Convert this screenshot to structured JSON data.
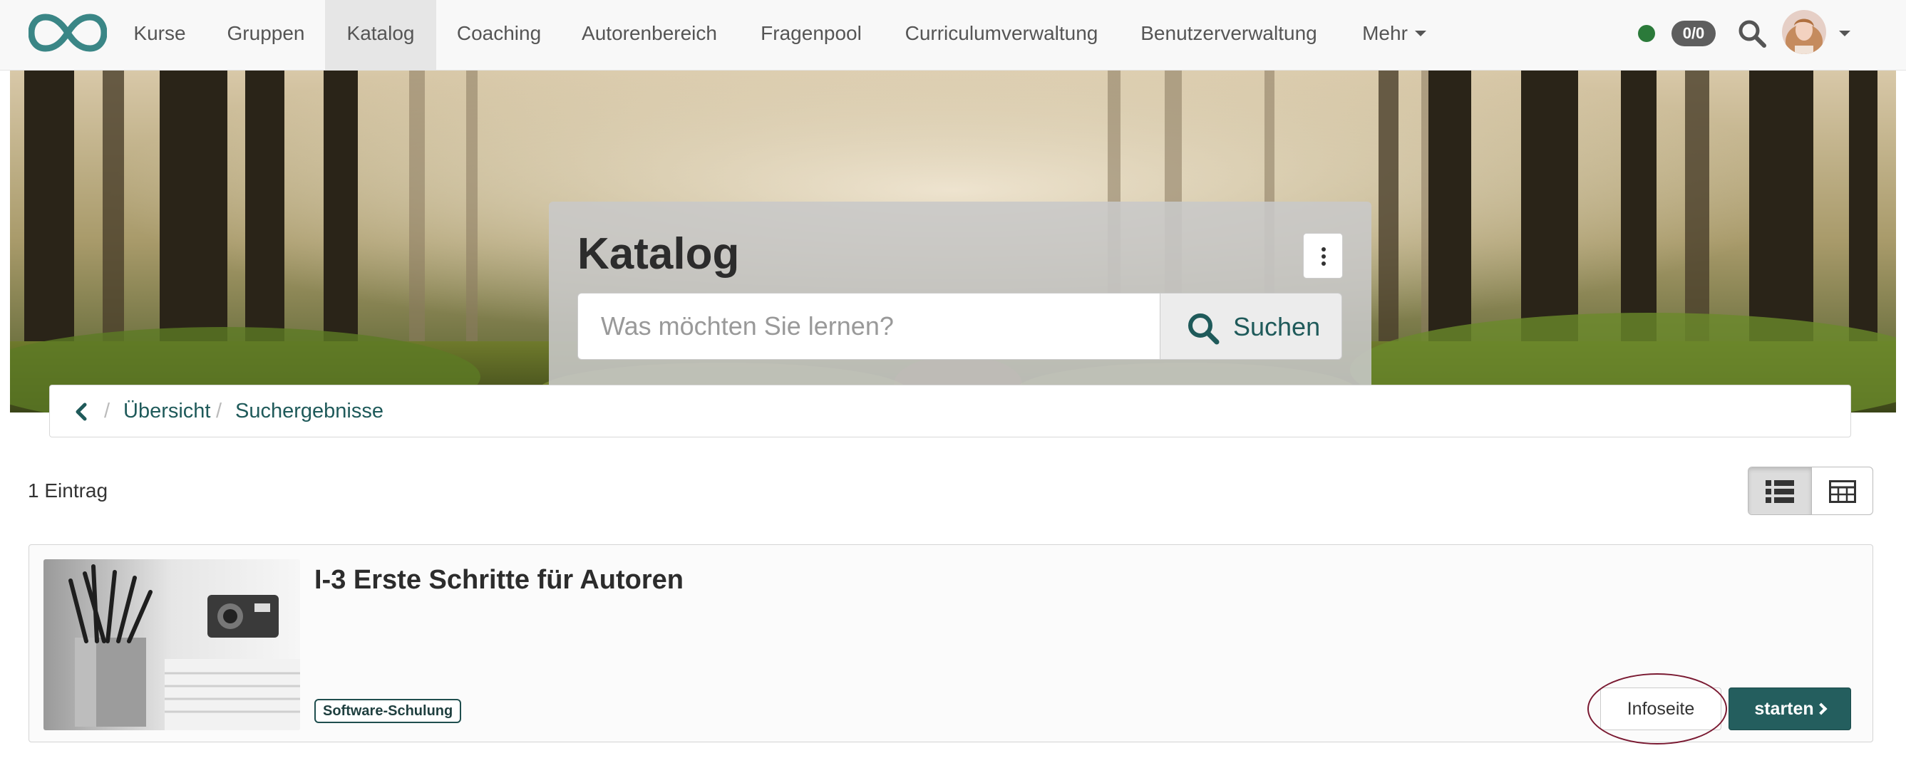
{
  "topnav": {
    "items": [
      {
        "label": "Kurse"
      },
      {
        "label": "Gruppen"
      },
      {
        "label": "Katalog",
        "active": true
      },
      {
        "label": "Coaching"
      },
      {
        "label": "Autorenbereich"
      },
      {
        "label": "Fragenpool"
      },
      {
        "label": "Curriculumverwaltung"
      },
      {
        "label": "Benutzerverwaltung"
      },
      {
        "label": "Mehr"
      }
    ],
    "status_color": "#2b7a3a",
    "badge": "0/0",
    "icons": {
      "logo": "infinity-logo-icon",
      "search": "search-icon",
      "avatar": "user-avatar",
      "menu": "caret-down-icon"
    }
  },
  "hero": {
    "title": "Katalog",
    "search_placeholder": "Was möchten Sie lernen?",
    "search_value": "",
    "search_button": "Suchen",
    "more_icon": "kebab-vertical-icon"
  },
  "breadcrumb": {
    "back_icon": "chevron-left-icon",
    "items": [
      "Übersicht",
      "Suchergebnisse"
    ],
    "separator": "/"
  },
  "results": {
    "count_text": "1 Eintrag",
    "view_modes": [
      "list-view-icon",
      "table-view-icon"
    ],
    "active_view": "list"
  },
  "course": {
    "title": "I-3 Erste Schritte für Autoren",
    "tag": "Software-Schulung",
    "info_button": "Infoseite",
    "start_button": "starten"
  },
  "colors": {
    "primary": "#245e5e",
    "link": "#1f5a5a",
    "highlight_ring": "#7a1a32",
    "logo": "#3a8686"
  }
}
